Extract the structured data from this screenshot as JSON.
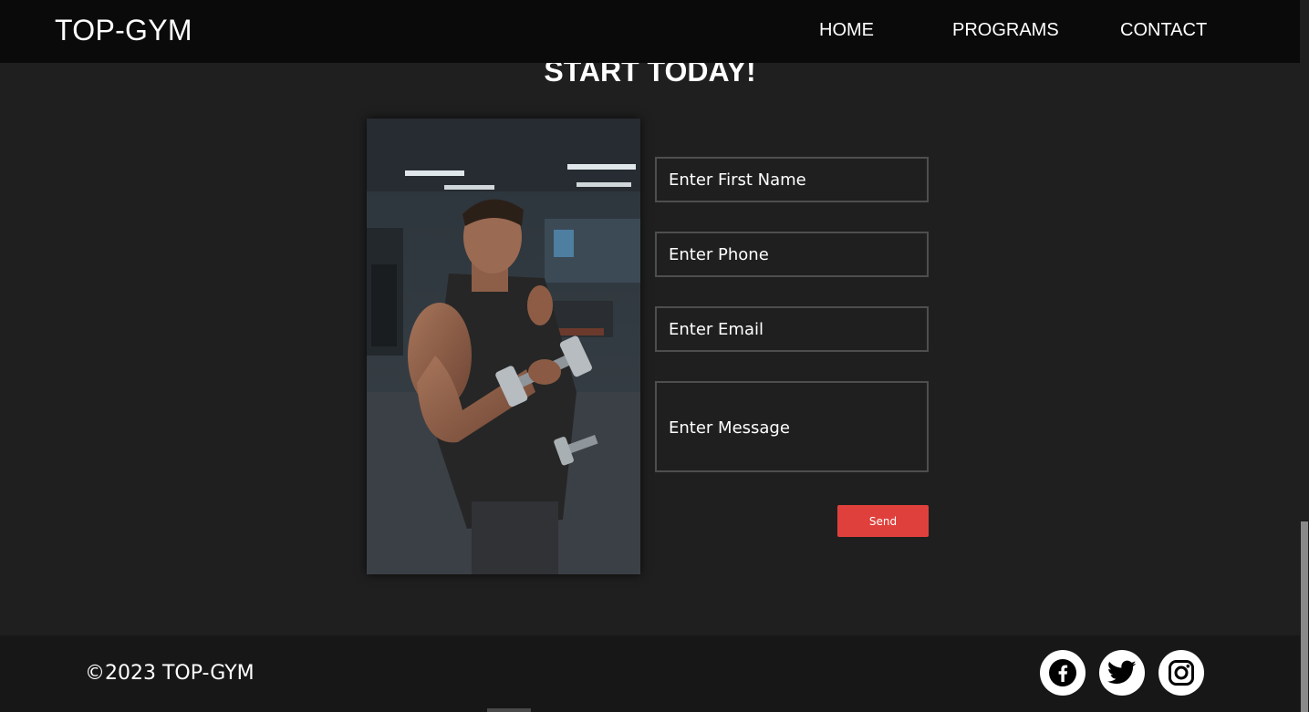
{
  "nav": {
    "brand": "TOP-GYM",
    "links": [
      "HOME",
      "PROGRAMS",
      "CONTACT"
    ]
  },
  "hero": {
    "heading": "START TODAY!"
  },
  "form": {
    "first_name_placeholder": "Enter First Name",
    "phone_placeholder": "Enter Phone",
    "email_placeholder": "Enter Email",
    "message_placeholder": "Enter Message",
    "send_label": "Send"
  },
  "footer": {
    "copyright": "©2023 TOP-GYM",
    "social_icons": [
      "facebook-icon",
      "twitter-icon",
      "instagram-icon"
    ]
  },
  "colors": {
    "background": "#1f1f1f",
    "navbar": "#0a0a0a",
    "footer": "#171717",
    "accent": "#e0403c"
  }
}
